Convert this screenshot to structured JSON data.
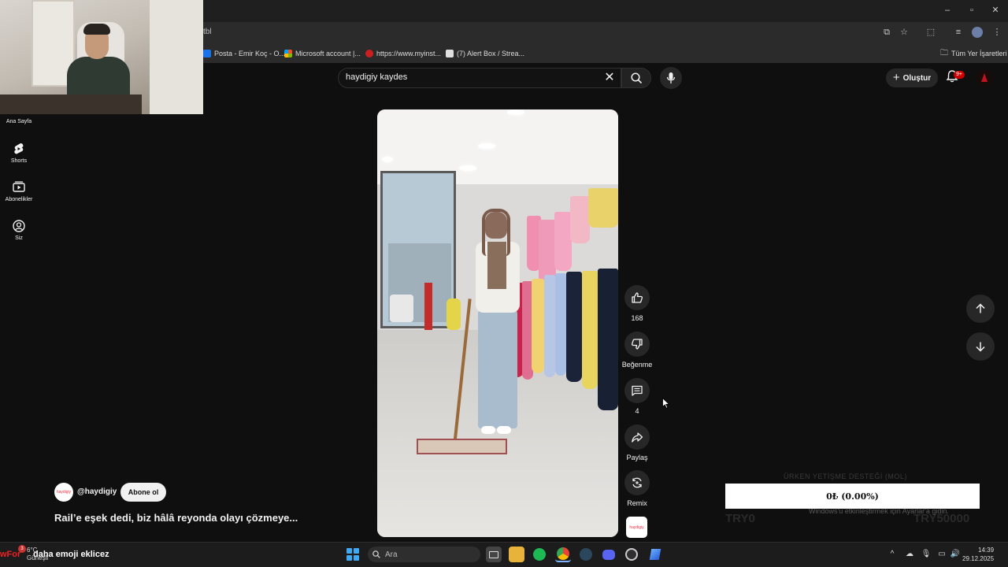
{
  "browser": {
    "url_fragment": "tbl",
    "bookmarks": [
      {
        "label": "Posta - Emir Koç - O...",
        "color": "#1a73e8"
      },
      {
        "label": "Microsoft account |...",
        "color": "#f25022"
      },
      {
        "label": "https://www.myinst...",
        "color": "#cc1f1f"
      },
      {
        "label": "(7) Alert Box / Strea...",
        "color": "#e0e0e0"
      }
    ],
    "all_bookmarks": "Tüm Yer İşaretleri"
  },
  "nav": {
    "home": "Ana Sayfa",
    "shorts": "Shorts",
    "subscriptions": "Abonelikler",
    "you": "Siz"
  },
  "search": {
    "query": "haydigiy kaydes"
  },
  "header": {
    "create": "Oluştur",
    "notif_count": "9+"
  },
  "short": {
    "likes": "168",
    "dislike": "Beğenme",
    "comments": "4",
    "share": "Paylaş",
    "remix": "Remix",
    "channel": "@haydigiy",
    "channel_logo_text": "haydigiy",
    "subscribe": "Abone ol",
    "title": "Rail’e eşek dedi, biz hâlâ reyonda olayı çözmeye..."
  },
  "donation": {
    "title": "ÜRKEN YETİŞME DESTEĞİ (MOL)",
    "progress_text": "0₺ (0.00%)",
    "progress_fraction": 0,
    "min": "TRY0",
    "max": "TRY50000",
    "windows_notice": "Windows'u etkinleştirmek için Ayarlar'a gidin."
  },
  "taskbar": {
    "weather_temp": "6°C",
    "weather_desc": "Güneşli",
    "weather_badge": "3",
    "overlay_red": "wFor",
    "overlay_text": "daha emoji eklicez",
    "search_placeholder": "Ara",
    "time": "14:39",
    "date": "29.12.2025"
  },
  "colors": {
    "yt_bg": "#0f0f0f",
    "yt_red": "#cc0000",
    "chip": "#272727"
  }
}
